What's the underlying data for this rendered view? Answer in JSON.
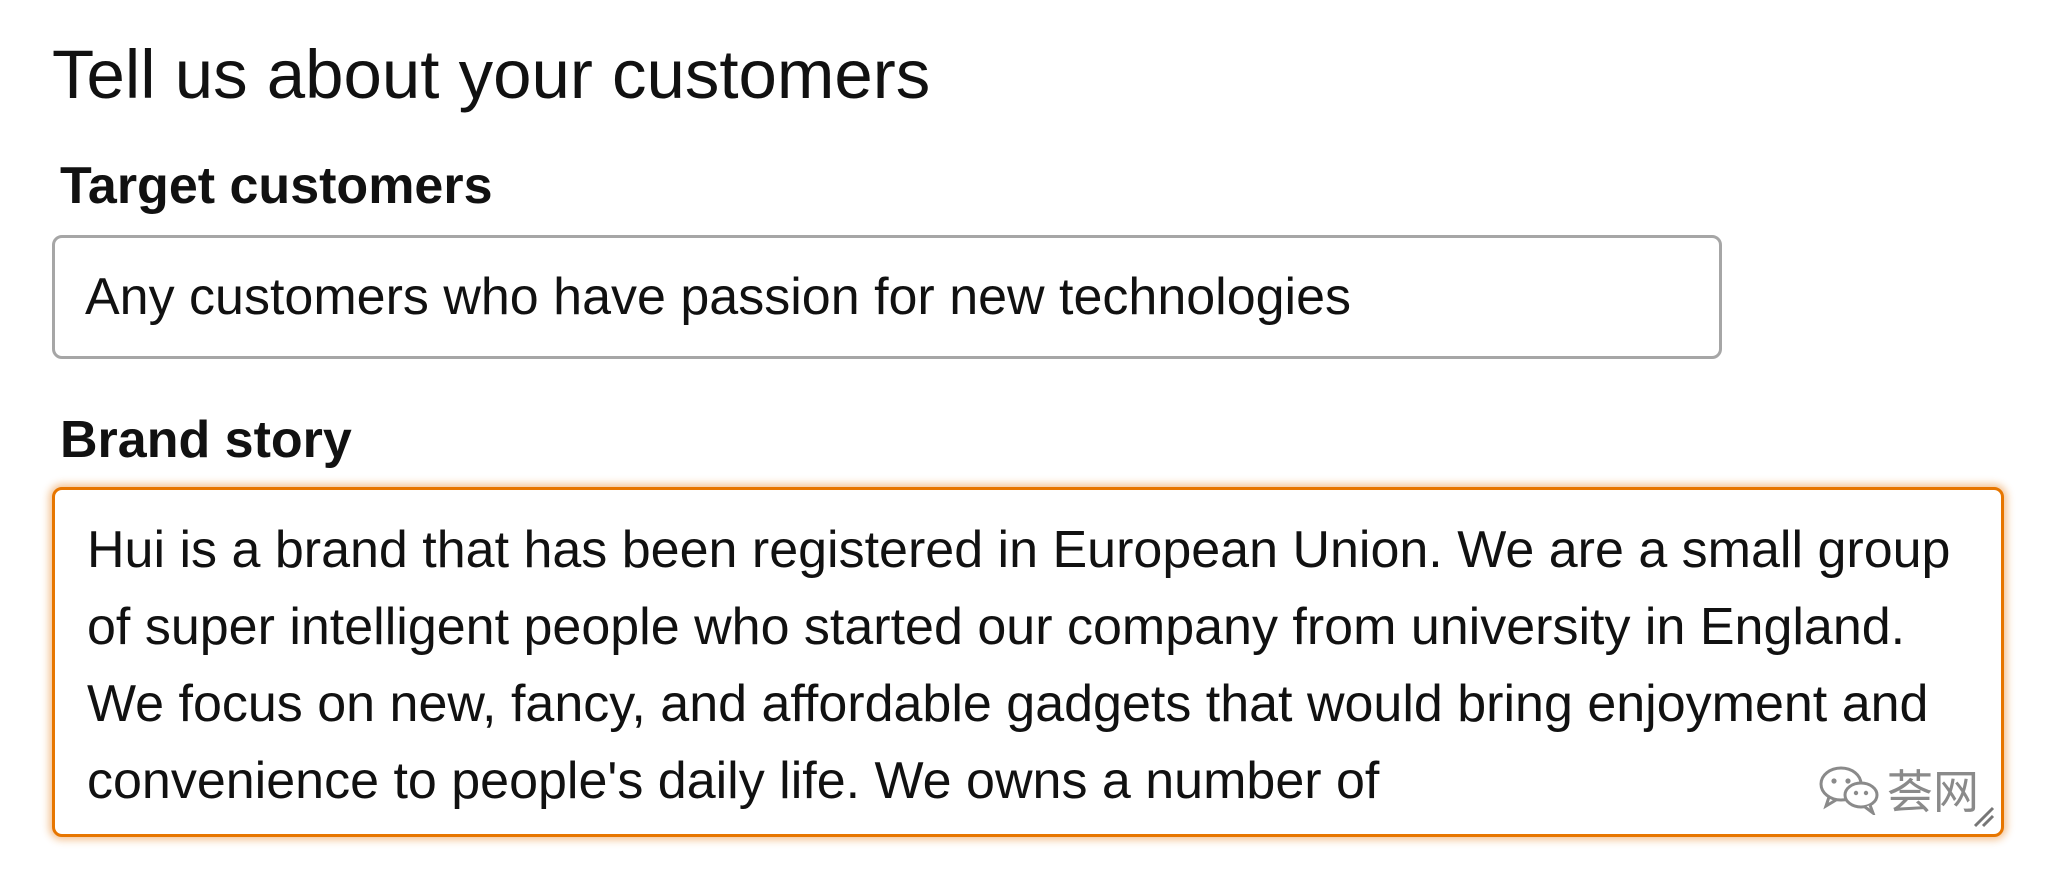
{
  "heading": "Tell us about your customers",
  "target_customers": {
    "label": "Target customers",
    "value": "Any customers who have passion for new technologies"
  },
  "brand_story": {
    "label": "Brand story",
    "value": "Hui is a brand that has been registered in European Union. We are a small group of super intelligent people who started our company from university in England. We focus on new, fancy, and affordable gadgets that would bring enjoyment and convenience to people's daily life. We owns a number of"
  },
  "watermark": {
    "text": "荟网",
    "icon": "wechat-icon"
  },
  "colors": {
    "focus_border": "#e77600",
    "input_border": "#a6a6a6",
    "text": "#111111"
  }
}
